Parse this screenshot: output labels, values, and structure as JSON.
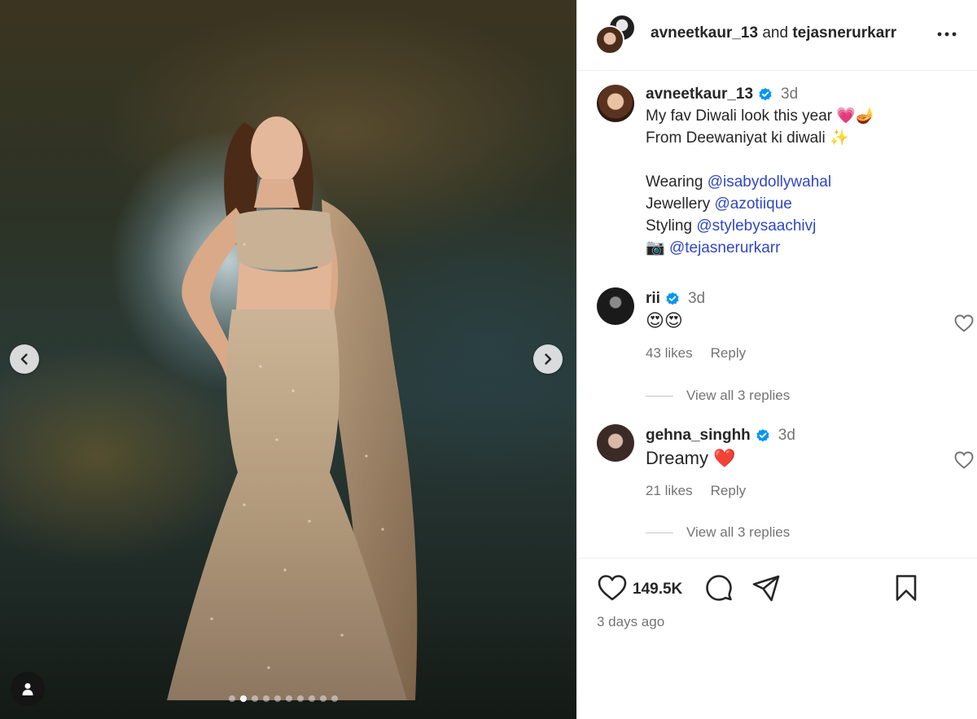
{
  "post": {
    "header": {
      "author": "avneetkaur_13",
      "joiner": "and",
      "collaborator": "tejasnerurkarr"
    },
    "carousel": {
      "slide_count": 10,
      "active_index": 1
    },
    "caption": {
      "username": "avneetkaur_13",
      "time": "3d",
      "lines": [
        {
          "text": "My fav Diwali look this year",
          "emoji": "💗🪔"
        },
        {
          "text": "From Deewaniyat ki diwali",
          "emoji": "✨"
        }
      ],
      "credits": [
        {
          "label": "Wearing",
          "mention": "@isabydollywahal"
        },
        {
          "label": "Jewellery",
          "mention": "@azotiique"
        },
        {
          "label": "Styling",
          "mention": "@stylebysaachivj"
        },
        {
          "label": "📷",
          "mention": "@tejasnerurkarr"
        }
      ]
    },
    "comments": [
      {
        "username": "rii",
        "time": "3d",
        "text": "😍😍",
        "likes": "43 likes",
        "reply": "Reply",
        "view_replies": "View all 3 replies"
      },
      {
        "username": "gehna_singhh",
        "time": "3d",
        "text": "Dreamy",
        "emoji": "❤️",
        "likes": "21 likes",
        "reply": "Reply",
        "view_replies": "View all 3 replies"
      }
    ],
    "like_count": "149.5K",
    "posted": "3 days ago"
  },
  "icons": {
    "more": "more-options-icon",
    "prev": "chevron-left-icon",
    "next": "chevron-right-icon",
    "user_tag": "user-tag-icon",
    "like": "heart-icon",
    "comment": "comment-icon",
    "share": "share-icon",
    "save": "bookmark-icon",
    "verified": "verified-badge-icon"
  },
  "colors": {
    "mention": "#2f47c4",
    "verified": "#0095f6",
    "muted": "#737373"
  }
}
